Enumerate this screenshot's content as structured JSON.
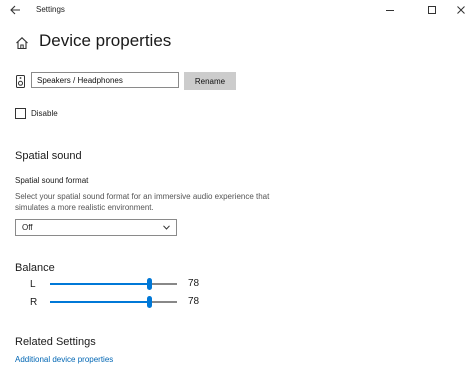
{
  "window": {
    "title": "Settings",
    "minimize_icon": "minimize-icon",
    "maximize_icon": "maximize-icon",
    "close_icon": "close-icon"
  },
  "page": {
    "title": "Device properties"
  },
  "device": {
    "name_value": "Speakers / Headphones",
    "rename_label": "Rename",
    "disable_label": "Disable",
    "disable_checked": false
  },
  "spatial": {
    "header": "Spatial sound",
    "format_label": "Spatial sound format",
    "description": "Select your spatial sound format for an immersive audio experience that simulates a more realistic environment.",
    "selected_format": "Off"
  },
  "balance": {
    "header": "Balance",
    "left": {
      "label": "L",
      "value": 78
    },
    "right": {
      "label": "R",
      "value": 78
    }
  },
  "related": {
    "header": "Related Settings",
    "link": "Additional device properties"
  },
  "colors": {
    "accent": "#0078d7",
    "link": "#0066b4"
  }
}
